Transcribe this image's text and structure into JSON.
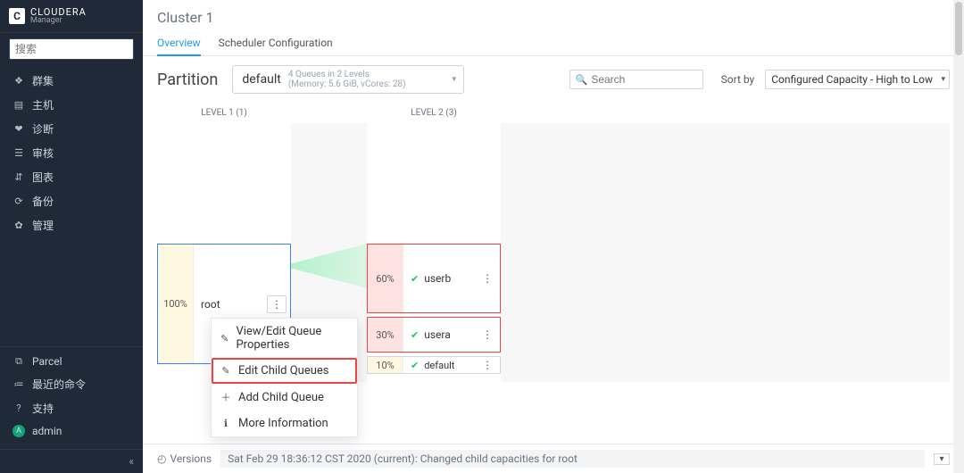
{
  "brand": {
    "badge": "C",
    "name": "CLOUDERA",
    "sub": "Manager"
  },
  "sidebar": {
    "search_placeholder": "搜索",
    "items": [
      {
        "icon": "clusters-icon",
        "glyph": "❖",
        "label": "群集"
      },
      {
        "icon": "hosts-icon",
        "glyph": "▤",
        "label": "主机"
      },
      {
        "icon": "diag-icon",
        "glyph": "❤",
        "label": "诊断"
      },
      {
        "icon": "audit-icon",
        "glyph": "☰",
        "label": "审核"
      },
      {
        "icon": "charts-icon",
        "glyph": "⇵",
        "label": "图表"
      },
      {
        "icon": "backup-icon",
        "glyph": "⟳",
        "label": "备份"
      },
      {
        "icon": "admin-icon",
        "glyph": "✿",
        "label": "管理"
      }
    ],
    "bottom": [
      {
        "icon": "parcel-icon",
        "glyph": "⧉",
        "label": "Parcel"
      },
      {
        "icon": "recent-icon",
        "glyph": "≔",
        "label": "最近的命令"
      },
      {
        "icon": "support-icon",
        "glyph": "?",
        "label": "支持"
      }
    ],
    "user": {
      "initial": "A",
      "label": "admin"
    },
    "collapse_glyph": "«"
  },
  "page": {
    "title": "Cluster 1",
    "tabs": [
      {
        "label": "Overview",
        "active": true
      },
      {
        "label": "Scheduler Configuration",
        "active": false
      }
    ],
    "partition_label": "Partition",
    "partition_select": {
      "value": "default",
      "sub1": "4 Queues in 2 Levels",
      "sub2": "(Memory: 5.6 GiB, vCores: 28)"
    },
    "search_placeholder": "Search",
    "sort_by_label": "Sort by",
    "sort_by_value": "Configured Capacity - High to Low",
    "levels": {
      "l1": "LEVEL 1 (1)",
      "l2": "LEVEL 2 (3)"
    }
  },
  "queues": {
    "root": {
      "pct": "100%",
      "name": "root"
    },
    "children": [
      {
        "pct": "60%",
        "name": "userb"
      },
      {
        "pct": "30%",
        "name": "usera"
      },
      {
        "pct": "10%",
        "name": "default"
      }
    ]
  },
  "context_menu": {
    "items": [
      {
        "icon": "pencil-icon",
        "glyph": "✎",
        "label": "View/Edit Queue Properties"
      },
      {
        "icon": "pencil-icon",
        "glyph": "✎",
        "label": "Edit Child Queues",
        "highlight": true
      },
      {
        "icon": "plus-icon",
        "glyph": "＋",
        "label": "Add Child Queue"
      },
      {
        "icon": "info-icon",
        "glyph": "ℹ",
        "label": "More Information"
      }
    ]
  },
  "footer": {
    "clock_glyph": "◴",
    "versions_label": "Versions",
    "message": "Sat Feb 29 18:36:12 CST 2020 (current): Changed child capacities for root"
  }
}
